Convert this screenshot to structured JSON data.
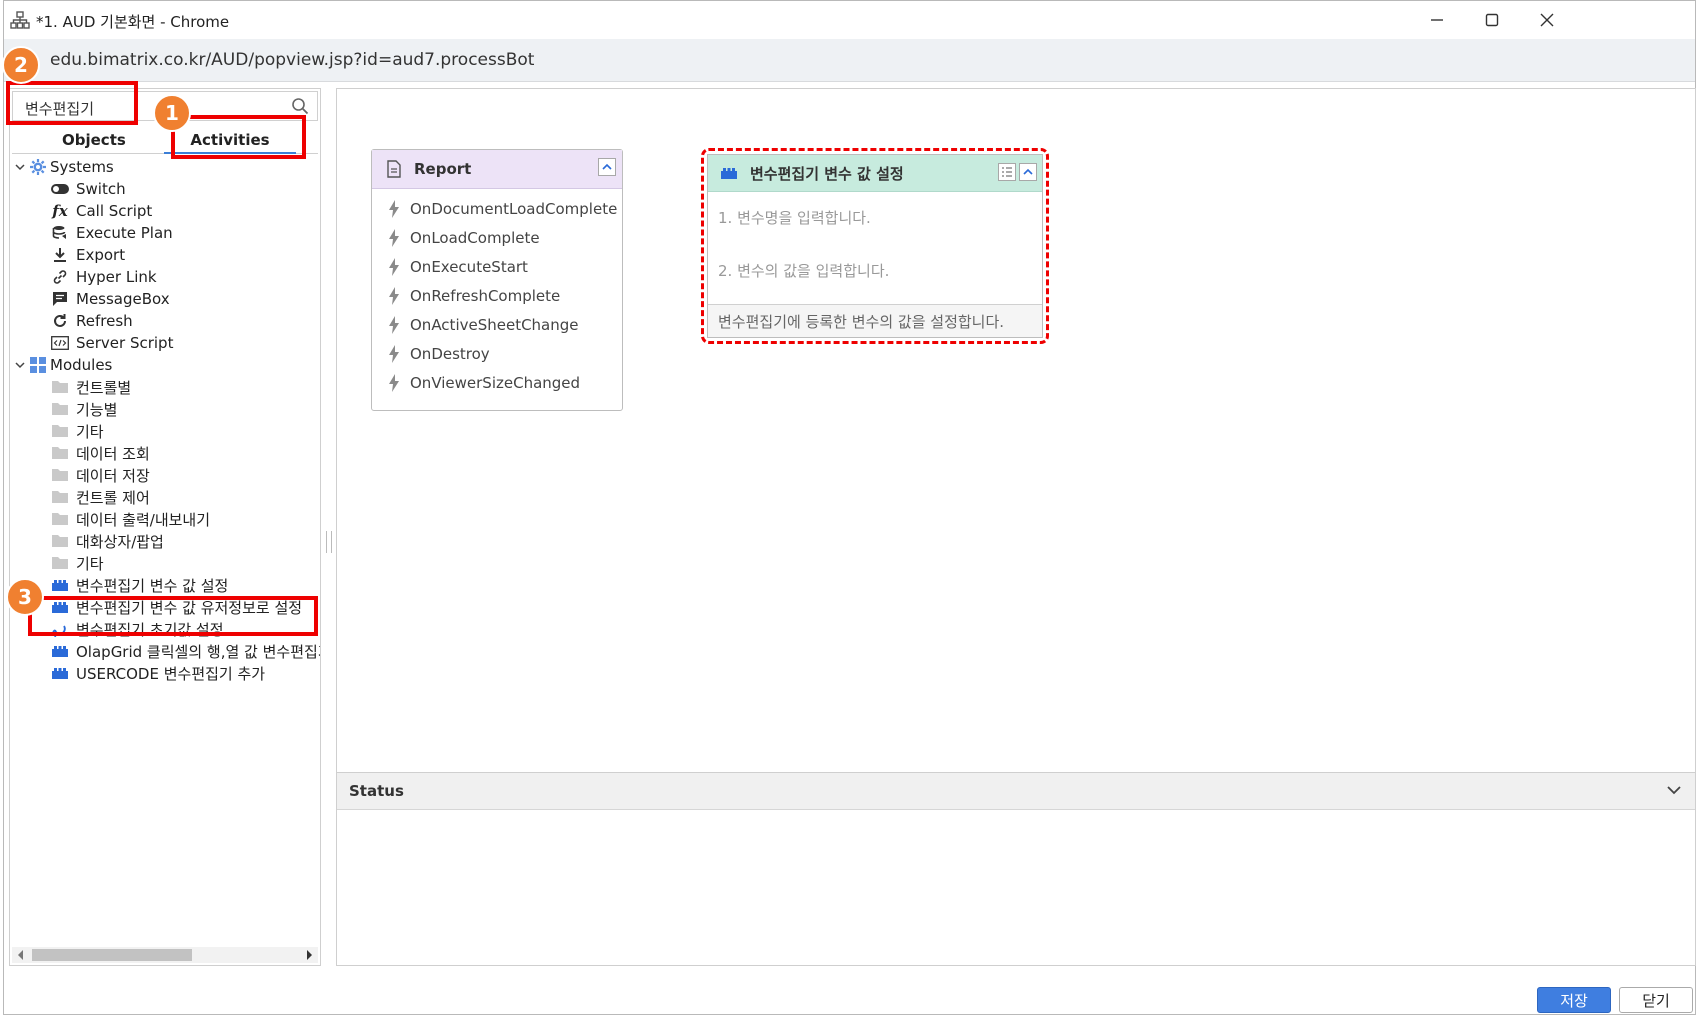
{
  "window": {
    "title": "*1. AUD 기본화면 - Chrome",
    "url": "edu.bimatrix.co.kr/AUD/popview.jsp?id=aud7.processBot"
  },
  "left_panel": {
    "search_value": "변수편집기",
    "tabs": [
      {
        "label": "Objects"
      },
      {
        "label": "Activities"
      }
    ],
    "tree": [
      {
        "label": "Systems",
        "icon": "gear-icon",
        "level": 0
      },
      {
        "label": "Switch",
        "icon": "toggle-icon",
        "level": 1
      },
      {
        "label": "Call Script",
        "icon": "function-icon",
        "level": 1
      },
      {
        "label": "Execute Plan",
        "icon": "database-icon",
        "level": 1
      },
      {
        "label": "Export",
        "icon": "download-icon",
        "level": 1
      },
      {
        "label": "Hyper Link",
        "icon": "link-icon",
        "level": 1
      },
      {
        "label": "MessageBox",
        "icon": "message-icon",
        "level": 1
      },
      {
        "label": "Refresh",
        "icon": "refresh-icon",
        "level": 1
      },
      {
        "label": "Server Script",
        "icon": "code-icon",
        "level": 1
      },
      {
        "label": "Modules",
        "icon": "grid-icon",
        "level": 0
      },
      {
        "label": "컨트롤별",
        "icon": "folder-icon",
        "level": 1
      },
      {
        "label": "기능별",
        "icon": "folder-icon",
        "level": 1
      },
      {
        "label": "기타",
        "icon": "folder-icon",
        "level": 1
      },
      {
        "label": "데이터 조회",
        "icon": "folder-icon",
        "level": 1
      },
      {
        "label": "데이터 저장",
        "icon": "folder-icon",
        "level": 1
      },
      {
        "label": "컨트롤 제어",
        "icon": "folder-icon",
        "level": 1
      },
      {
        "label": "데이터 출력/내보내기",
        "icon": "folder-icon",
        "level": 1
      },
      {
        "label": "대화상자/팝업",
        "icon": "folder-icon",
        "level": 1
      },
      {
        "label": "기타",
        "icon": "folder-icon",
        "level": 1
      },
      {
        "label": "변수편집기 변수 값 설정",
        "icon": "module-block-icon",
        "level": 1
      },
      {
        "label": "변수편집기 변수 값 유저정보로 설정",
        "icon": "module-block-icon",
        "level": 1
      },
      {
        "label": "변수편집기 초기값 설정",
        "icon": "restore-icon",
        "level": 1
      },
      {
        "label": "OlapGrid 클릭셀의 행,열 값 변수편집기",
        "icon": "module-block-icon",
        "level": 1
      },
      {
        "label": "USERCODE 변수편집기 추가",
        "icon": "module-block-icon",
        "level": 1
      }
    ]
  },
  "canvas": {
    "report_node": {
      "title": "Report",
      "events": [
        "OnDocumentLoadComplete",
        "OnLoadComplete",
        "OnExecuteStart",
        "OnRefreshComplete",
        "OnActiveSheetChange",
        "OnDestroy",
        "OnViewerSizeChanged"
      ]
    },
    "variable_node": {
      "title": "변수편집기 변수 값 설정",
      "hint1": "1. 변수명을 입력합니다.",
      "hint2": "2. 변수의 값을 입력합니다.",
      "footer": "변수편집기에 등록한 변수의 값을 설정합니다."
    }
  },
  "status": {
    "label": "Status"
  },
  "buttons": {
    "save": "저장",
    "close": "닫기"
  },
  "badges": [
    "1",
    "2",
    "3"
  ],
  "colors": {
    "accent": "#3f7ee0",
    "highlight": "#ee0000",
    "badge": "#f08030",
    "report_header": "#ede3f7",
    "variable_header": "#c7ebde"
  }
}
